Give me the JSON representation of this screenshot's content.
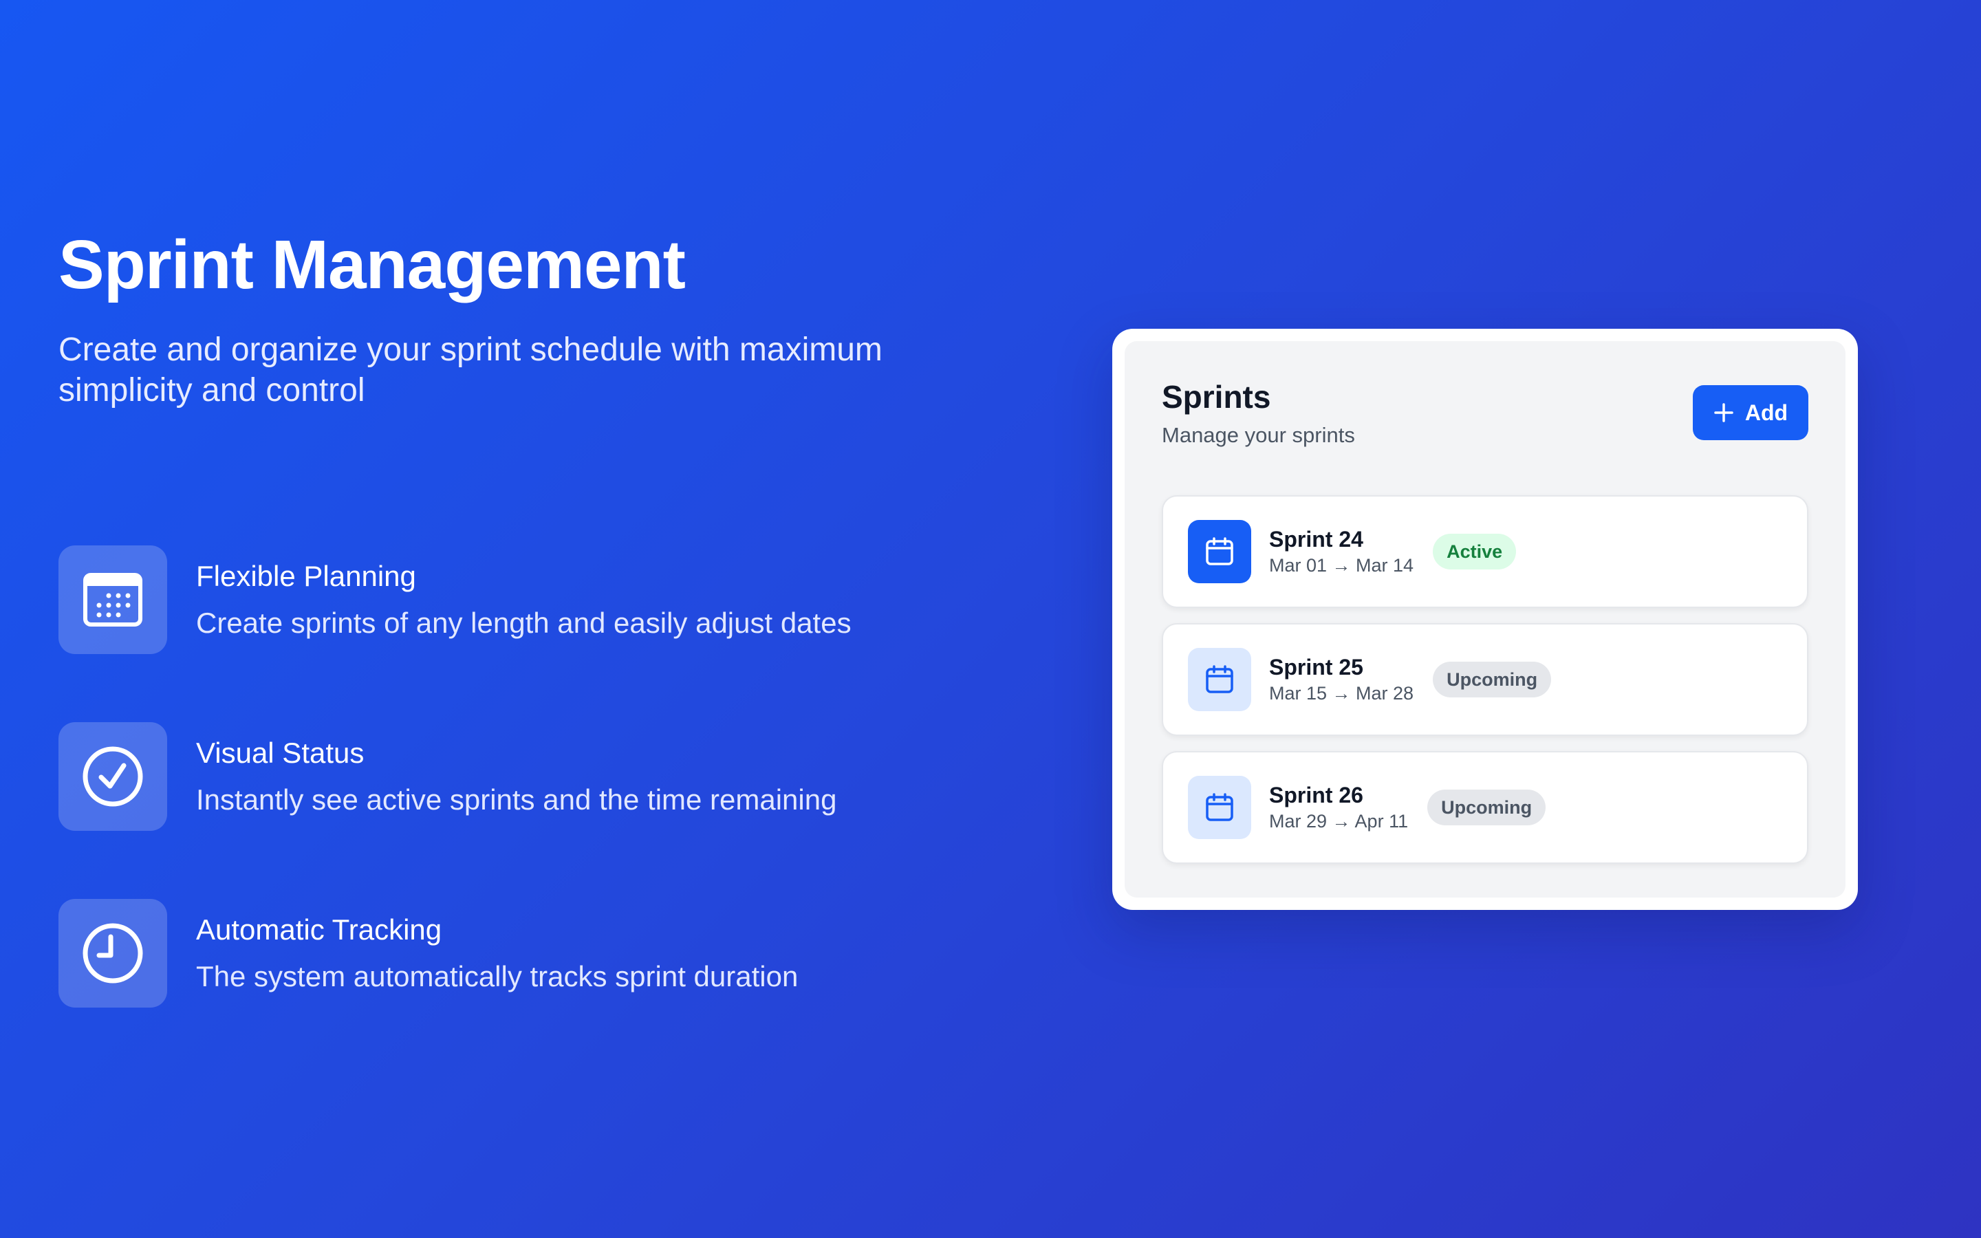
{
  "hero": {
    "title": "Sprint Management",
    "subtitle": "Create and organize your sprint schedule with maximum simplicity and control"
  },
  "features": [
    {
      "icon": "calendar-icon",
      "title": "Flexible Planning",
      "description": "Create sprints of any length and easily adjust dates"
    },
    {
      "icon": "check-circle-icon",
      "title": "Visual Status",
      "description": "Instantly see active sprints and the time remaining"
    },
    {
      "icon": "clock-icon",
      "title": "Automatic Tracking",
      "description": "The system automatically tracks sprint duration"
    }
  ],
  "panel": {
    "title": "Sprints",
    "subtitle": "Manage your sprints",
    "add_label": "Add"
  },
  "sprints": [
    {
      "name": "Sprint 24",
      "dates": "Mar 01 → Mar 14",
      "status": "Active"
    },
    {
      "name": "Sprint 25",
      "dates": "Mar 15 → Mar 28",
      "status": "Upcoming"
    },
    {
      "name": "Sprint 26",
      "dates": "Mar 29 → Apr 11",
      "status": "Upcoming"
    }
  ],
  "colors": {
    "background_start": "#1757f2",
    "background_end": "#2e33c2",
    "accent": "#175ef5",
    "active_badge_bg": "#dcfce7",
    "active_badge_text": "#15803d",
    "upcoming_badge_bg": "#e5e7eb",
    "upcoming_badge_text": "#4b5563"
  }
}
